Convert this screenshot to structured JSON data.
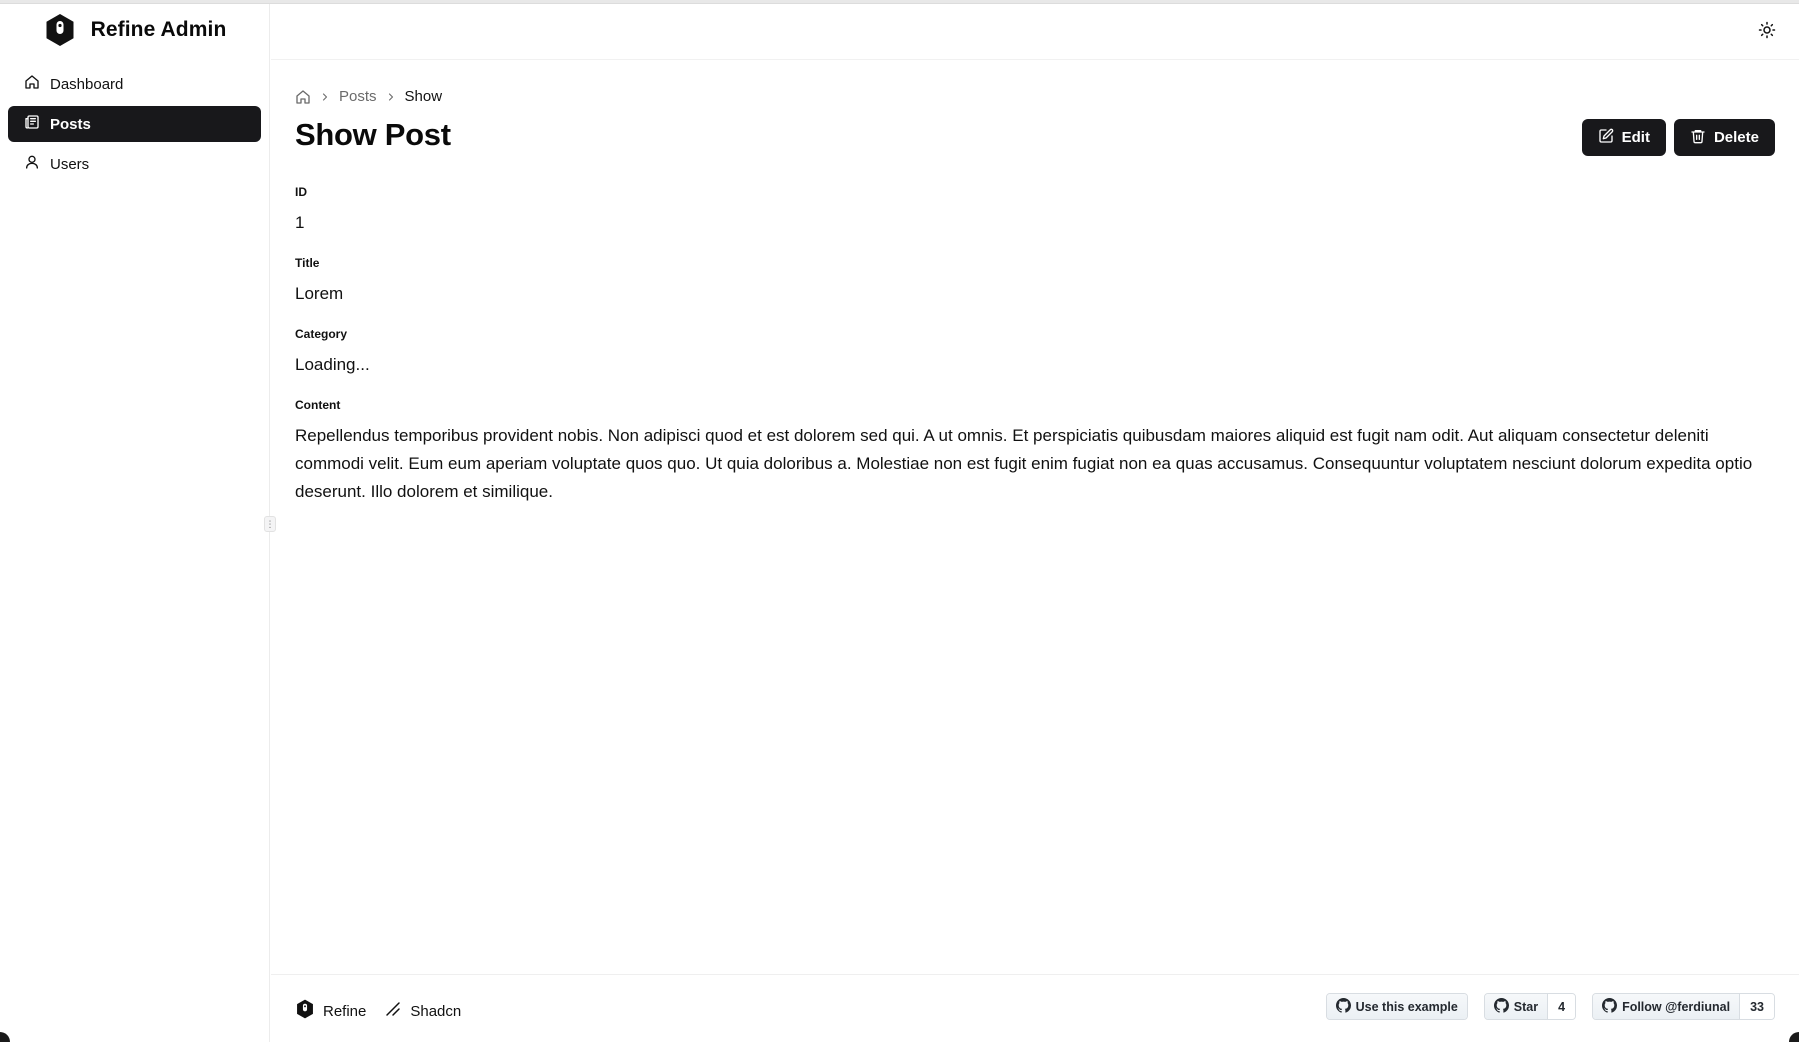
{
  "app": {
    "brand_title": "Refine Admin"
  },
  "sidebar": {
    "items": [
      {
        "label": "Dashboard",
        "icon": "home-icon"
      },
      {
        "label": "Posts",
        "icon": "newspaper-icon",
        "active": true
      },
      {
        "label": "Users",
        "icon": "user-icon"
      }
    ]
  },
  "breadcrumb": {
    "items": [
      "Posts",
      "Show"
    ]
  },
  "page": {
    "title": "Show Post",
    "edit_label": "Edit",
    "delete_label": "Delete"
  },
  "fields": [
    {
      "label": "ID",
      "value": "1"
    },
    {
      "label": "Title",
      "value": "Lorem"
    },
    {
      "label": "Category",
      "value": "Loading..."
    },
    {
      "label": "Content",
      "value": "Repellendus temporibus provident nobis. Non adipisci quod et est dolorem sed qui. A ut omnis. Et perspiciatis quibusdam maiores aliquid est fugit nam odit. Aut aliquam consectetur deleniti commodi velit. Eum eum aperiam voluptate quos quo. Ut quia doloribus a. Molestiae non est fugit enim fugiat non ea quas accusamus. Consequuntur voluptatem nesciunt dolorum expedita optio deserunt. Illo dolorem et similique."
    }
  ],
  "footer": {
    "refine_label": "Refine",
    "shadcn_label": "Shadcn",
    "use_example_label": "Use this example",
    "star_label": "Star",
    "star_count": "4",
    "follow_label": "Follow @ferdiunal",
    "follow_count": "33"
  },
  "colors": {
    "primary": "#18181b",
    "muted_text": "#6b6b6b",
    "border": "#ececec"
  }
}
